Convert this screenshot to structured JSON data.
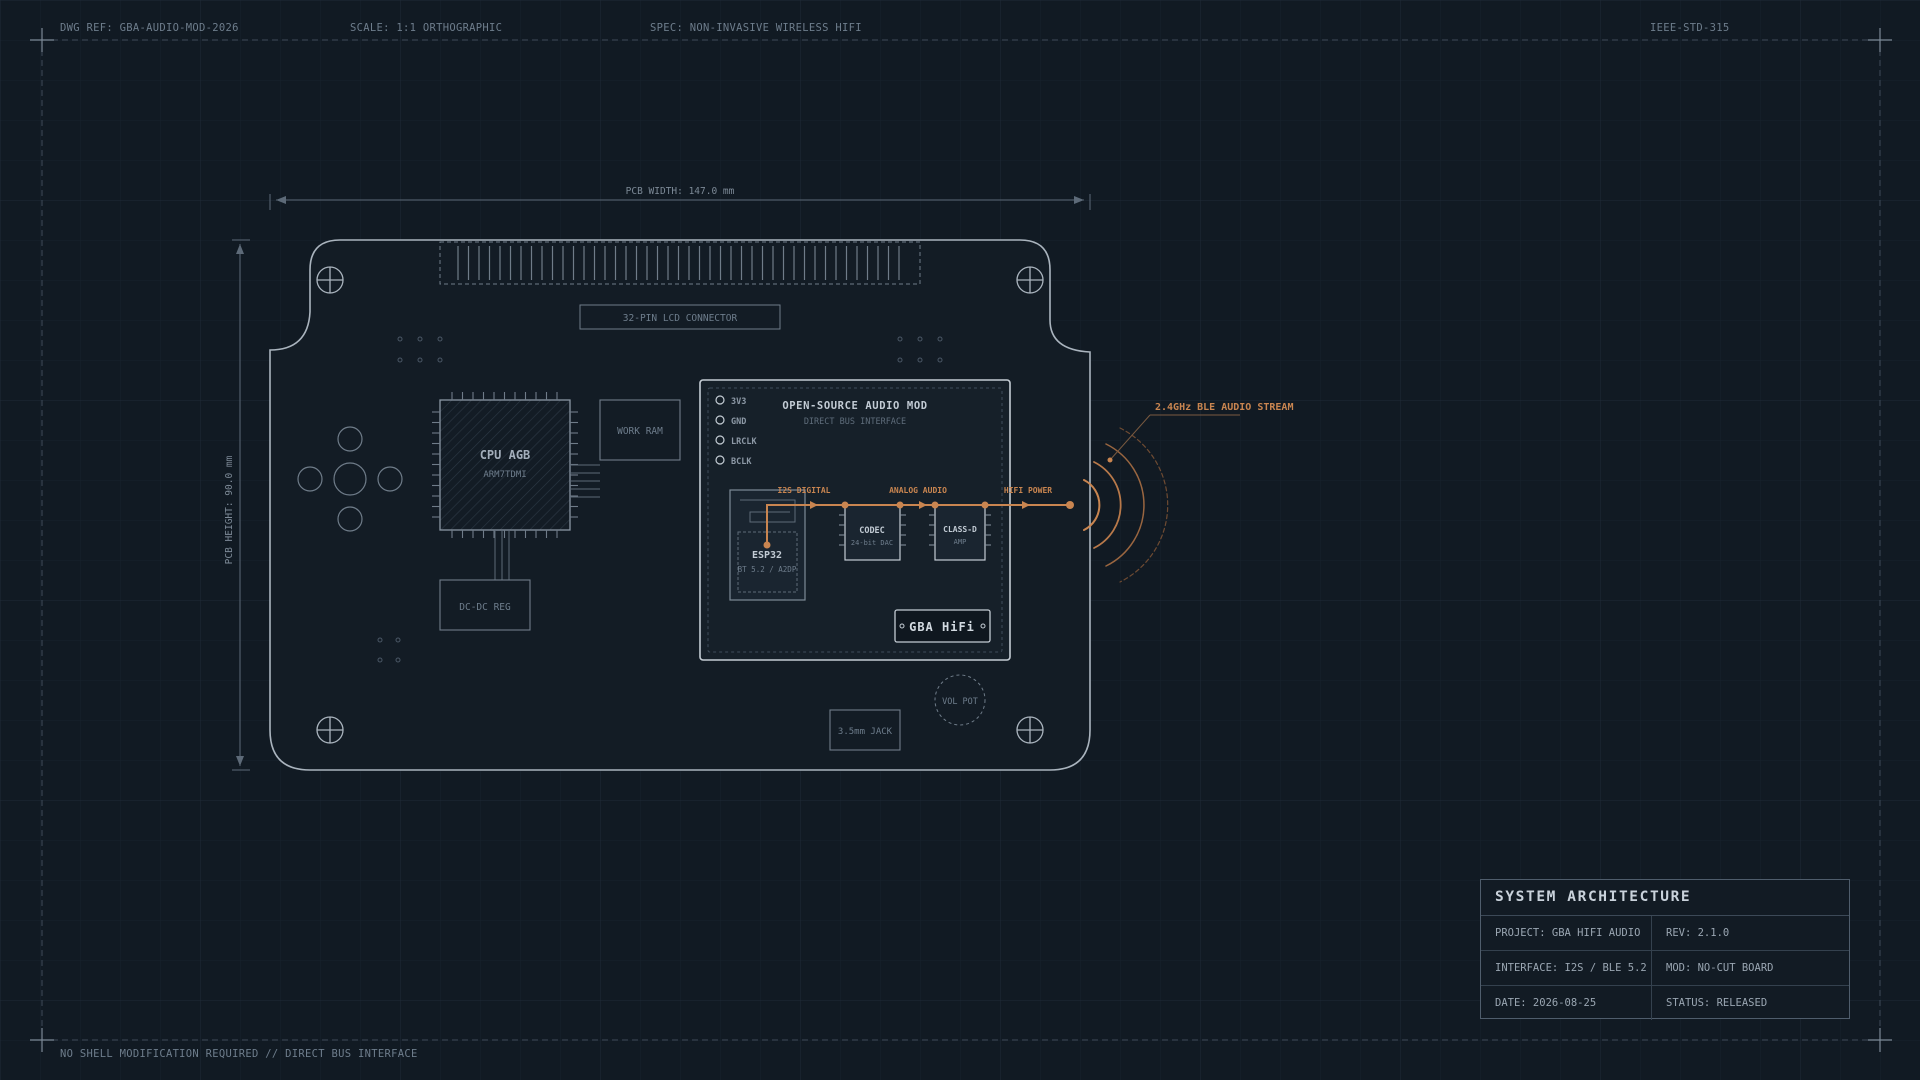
{
  "header": {
    "dwg_ref": "DWG REF: GBA-AUDIO-MOD-2026",
    "scale": "SCALE: 1:1 ORTHOGRAPHIC",
    "spec": "SPEC: NON-INVASIVE WIRELESS HIFI",
    "standard": "IEEE-STD-315"
  },
  "footer": {
    "note": "NO SHELL MODIFICATION REQUIRED // DIRECT BUS INTERFACE"
  },
  "dimensions": {
    "width_label": "PCB WIDTH: 147.0 mm",
    "height_label": "PCB HEIGHT: 90.0 mm"
  },
  "board": {
    "lcd_connector": "32-PIN LCD CONNECTOR",
    "cpu": {
      "name": "CPU AGB",
      "sub": "ARM7TDMI"
    },
    "work_ram": "WORK RAM",
    "dcdc": "DC-DC REG",
    "jack": "3.5mm JACK",
    "vol_pot": "VOL POT"
  },
  "mod": {
    "title": "OPEN-SOURCE AUDIO MOD",
    "subtitle": "DIRECT BUS INTERFACE",
    "pins": [
      "3V3",
      "GND",
      "LRCLK",
      "BCLK"
    ],
    "esp32": {
      "name": "ESP32",
      "sub": "BT 5.2 / A2DP"
    },
    "codec": {
      "name": "CODEC",
      "sub": "24-bit DAC"
    },
    "amp": {
      "name": "CLASS-D",
      "sub": "AMP"
    },
    "signals": {
      "i2s": "I2S DIGITAL",
      "analog": "ANALOG AUDIO",
      "power": "HIFI POWER"
    },
    "badge": "GBA HiFi"
  },
  "wireless_label": "2.4GHz BLE AUDIO STREAM",
  "title_block": {
    "heading": "SYSTEM ARCHITECTURE",
    "project": "PROJECT: GBA HIFI AUDIO",
    "rev": "REV: 2.1.0",
    "interface": "INTERFACE: I2S / BLE 5.2",
    "mod": "MOD: NO-CUT BOARD",
    "date": "DATE: 2026-08-25",
    "status": "STATUS: RELEASED"
  },
  "colors": {
    "background": "#111a23",
    "grid": "#1c2733",
    "line": "#8a96a3",
    "accent": "#c98550",
    "text_dim": "#6e7d8c"
  }
}
